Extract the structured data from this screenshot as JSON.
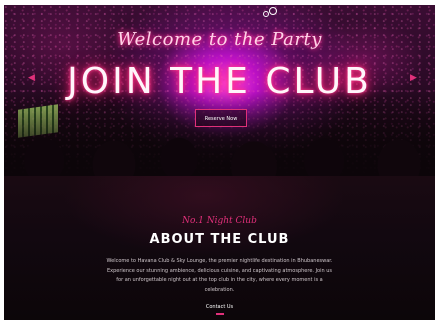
{
  "hero": {
    "tagline": "Welcome to the Party",
    "title": "JOIN THE CLUB",
    "cta_label": "Reserve Now",
    "prev_icon": "chevron-left-icon",
    "next_icon": "chevron-right-icon"
  },
  "about": {
    "kicker": "No.1 Night Club",
    "title": "ABOUT THE CLUB",
    "lines": [
      "Welcome to Havana Club & Sky Lounge, the premier nightlife destination in Bhubaneswar.",
      "Experience our stunning ambience, delicious cuisine, and captivating atmosphere. Join us",
      "for an unforgettable night out at the top club in the city, where every moment is a",
      "celebration."
    ],
    "contact_label": "Contact Us"
  },
  "colors": {
    "accent": "#e0307a",
    "background": "#0d0609"
  }
}
